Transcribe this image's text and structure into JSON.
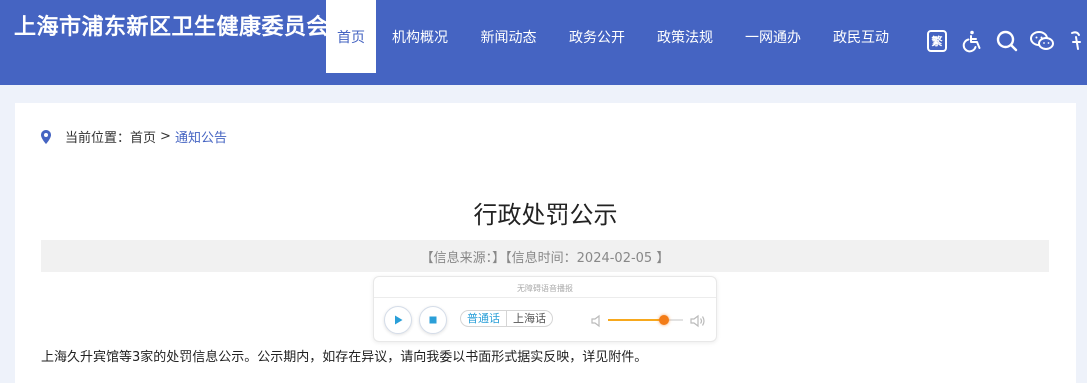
{
  "header": {
    "site_title": "上海市浦东新区卫生健康委员会",
    "nav": [
      {
        "label": "首页",
        "active": true
      },
      {
        "label": "机构概况",
        "active": false
      },
      {
        "label": "新闻动态",
        "active": false
      },
      {
        "label": "政务公开",
        "active": false
      },
      {
        "label": "政策法规",
        "active": false
      },
      {
        "label": "一网通办",
        "active": false
      },
      {
        "label": "政民互动",
        "active": false
      }
    ],
    "tools": {
      "traditional_label": "繁",
      "icons": [
        "traditional-chinese-icon",
        "accessibility-icon",
        "search-icon",
        "wechat-icon",
        "weibo-icon"
      ]
    },
    "brand_color": "#4564c2"
  },
  "breadcrumb": {
    "prefix": "当前位置：",
    "home": "首页",
    "separator": ">",
    "current": "通知公告"
  },
  "article": {
    "title": "行政处罚公示",
    "meta": "【信息来源：】【信息时间：2024-02-05 】",
    "body": "上海久升宾馆等3家的处罚信息公示。公示期内，如存在异议，请向我委以书面形式据实反映，详见附件。"
  },
  "player": {
    "label": "无障碍语音播报",
    "lang_options": [
      "普通话",
      "上海话"
    ],
    "selected_lang": "普通话",
    "volume": 0.75,
    "accent_color": "#2a9fd8",
    "volume_color": "#f37c17"
  }
}
